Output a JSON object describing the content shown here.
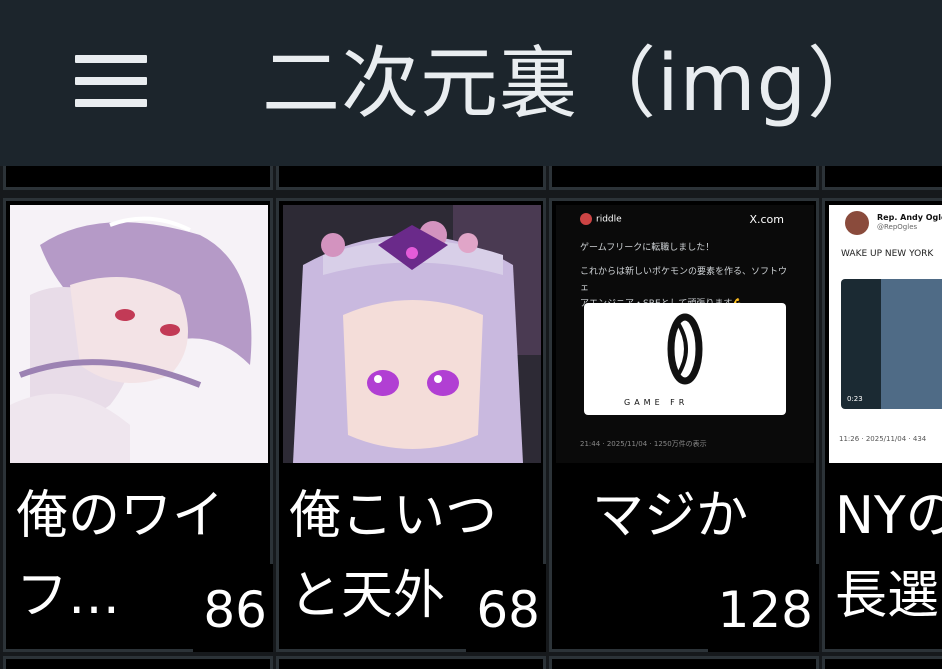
{
  "header": {
    "title": "二次元裏（img）"
  },
  "cards": [
    {
      "count": "86",
      "caption": "俺のワイフ…",
      "caption_lines": [
        "俺のワイ",
        "フ…"
      ]
    },
    {
      "count": "68",
      "caption": "俺こいつと天外",
      "caption_lines": [
        "俺こいつ",
        "と天外"
      ]
    },
    {
      "count": "128",
      "caption": "マジか",
      "caption_lines": [
        "マジか",
        ""
      ]
    },
    {
      "count": "",
      "caption": "NYの長選",
      "caption_lines": [
        "NYの",
        "長選"
      ]
    }
  ],
  "tweet1": {
    "account": "riddle",
    "site": "X.com",
    "line1": "ゲームフリークに転職しました！",
    "line2": "これからは新しいポケモンの要素を作る、ソフトウェ",
    "line3": "アエンジニア・SREとして頑張ります💪",
    "logo_text": "GAME FR",
    "meta": "21:44 · 2025/11/04 · 1250万件の表示"
  },
  "tweet2": {
    "account": "Rep. Andy Ogles",
    "handle": "@RepOgles",
    "line1": "WAKE UP NEW YORK",
    "duration": "0:23",
    "meta": "11:26 · 2025/11/04 · 434"
  },
  "colors": {
    "header_bg": "#1c252c",
    "page_bg": "#16191c",
    "card_border": "#2c3338",
    "text": "#ffffff"
  }
}
